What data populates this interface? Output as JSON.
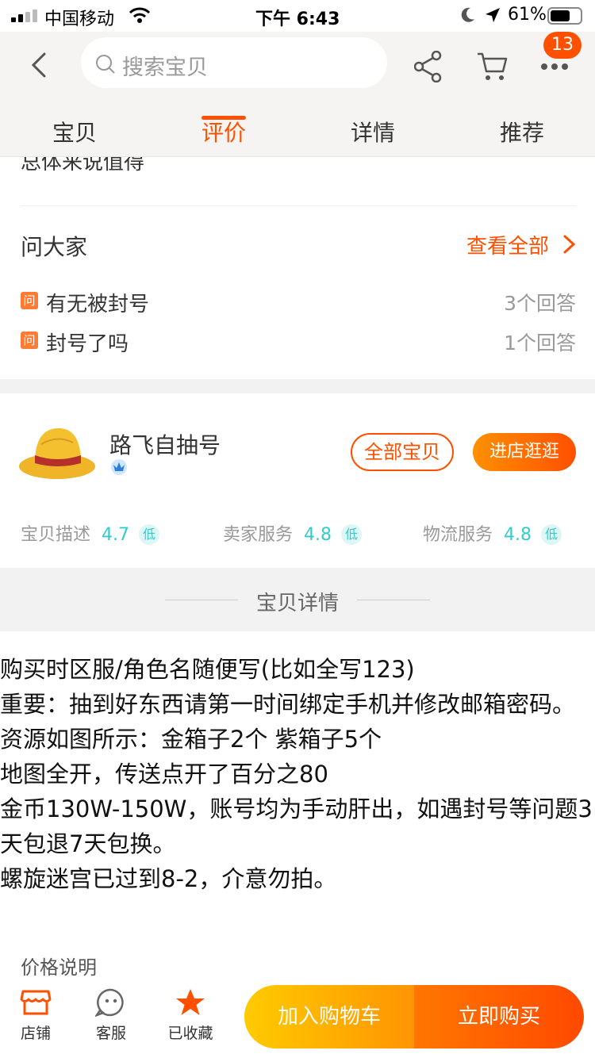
{
  "status": {
    "carrier": "中国移动",
    "time": "下午 6:43",
    "battery": "61%"
  },
  "header": {
    "search_placeholder": "搜索宝贝",
    "badge_count": "13",
    "tabs": [
      {
        "label": "宝贝"
      },
      {
        "label": "评价"
      },
      {
        "label": "详情"
      },
      {
        "label": "推荐"
      }
    ],
    "active_tab": "评价"
  },
  "review": {
    "snippet": "总体来说值得"
  },
  "qa": {
    "title": "问大家",
    "view_all": "查看全部",
    "tag": "问",
    "questions": [
      {
        "text": "有无被封号",
        "answers": "3个回答"
      },
      {
        "text": "封号了吗",
        "answers": "1个回答"
      }
    ]
  },
  "shop": {
    "name": "路飞自抽号",
    "all_items": "全部宝贝",
    "enter_shop": "进店逛逛",
    "scores": [
      {
        "label": "宝贝描述",
        "value": "4.7",
        "level": "低"
      },
      {
        "label": "卖家服务",
        "value": "4.8",
        "level": "低"
      },
      {
        "label": "物流服务",
        "value": "4.8",
        "level": "低"
      }
    ]
  },
  "detail": {
    "title": "宝贝详情",
    "lines": [
      "购买时区服/角色名随便写(比如全写123)",
      "重要：抽到好东西请第一时间绑定手机并修改邮箱密码。",
      "资源如图所示：金箱子2个 紫箱子5个",
      "地图全开，传送点开了百分之80",
      "金币130W-150W，账号均为手动肝出，如遇封号等问题3天包退7天包换。",
      "螺旋迷宫已过到8-2，介意勿拍。"
    ],
    "price_title": "价格说明"
  },
  "bottom": {
    "shop": "店铺",
    "service": "客服",
    "favorited": "已收藏",
    "add_cart": "加入购物车",
    "buy_now": "立即购买"
  },
  "colors": {
    "accent": "#ff5000",
    "score": "#33cccc"
  }
}
